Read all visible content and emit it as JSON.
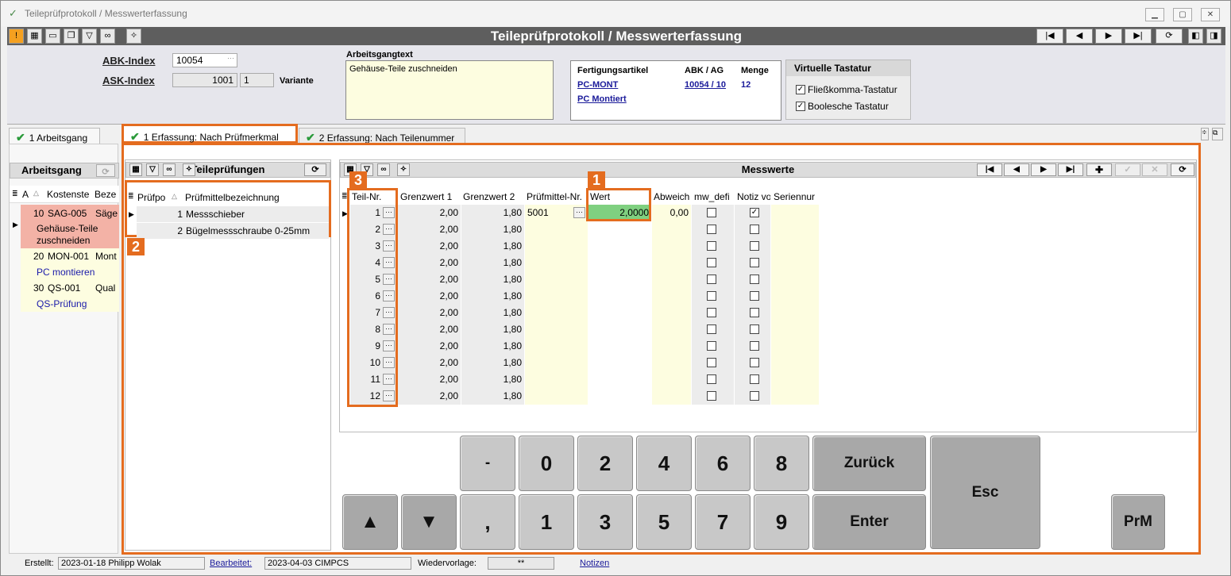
{
  "window": {
    "title": "Teileprüfprotokoll / Messwerterfassung",
    "app_title": "Teileprüfprotokoll / Messwerterfassung"
  },
  "header": {
    "abk_label": "ABK-Index",
    "abk_value": "10054",
    "ask_label": "ASK-Index",
    "ask_value": "1001",
    "ask_value2": "1",
    "variante_label": "Variante",
    "arbeitsgangtext_label": "Arbeitsgangtext",
    "arbeitsgangtext": "Gehäuse-Teile zuschneiden",
    "fert": {
      "col1": "Fertigungsartikel",
      "col2": "ABK / AG",
      "col3": "Menge",
      "article": "PC-MONT",
      "abk_ag": "10054 / 10",
      "menge": "12",
      "desc": "PC Montiert"
    },
    "vt": {
      "title": "Virtuelle Tastatur",
      "opt1": "Fließkomma-Tastatur",
      "opt2": "Boolesche Tastatur"
    }
  },
  "tabs": {
    "t1": "1 Arbeitsgang",
    "t2": "1 Erfassung: Nach Prüfmerkmal",
    "t3": "2 Erfassung: Nach Teilenummer"
  },
  "arbeitsgang": {
    "title": "Arbeitsgang",
    "cols": [
      "A",
      "Kostenste",
      "Beze"
    ],
    "rows": [
      {
        "a": "10",
        "k": "SAG-005",
        "b": "Säge",
        "desc": "Gehäuse-Teile zuschneiden"
      },
      {
        "a": "20",
        "k": "MON-001",
        "b": "Mont",
        "desc": "PC montieren"
      },
      {
        "a": "30",
        "k": "QS-001",
        "b": "Qual",
        "desc": "QS-Prüfung"
      }
    ]
  },
  "teilepruefungen": {
    "title": "Teileprüfungen",
    "cols": [
      "Prüfpo",
      "Prüfmittelbezeichnung"
    ],
    "rows": [
      {
        "n": "1",
        "name": "Messschieber"
      },
      {
        "n": "2",
        "name": "Bügelmessschraube 0-25mm"
      }
    ]
  },
  "messwerte": {
    "title": "Messwerte",
    "cols": [
      "Teil-Nr.",
      "Grenzwert 1",
      "Grenzwert 2",
      "Prüfmittel-Nr.",
      "Wert",
      "Abweich",
      "mw_defi",
      "Notiz vo",
      "Seriennur"
    ],
    "first_pm": "5001",
    "first_wert": "2,0000",
    "first_abw": "0,00",
    "g1": "2,00",
    "g2": "1,80",
    "rows": [
      "1",
      "2",
      "3",
      "4",
      "5",
      "6",
      "7",
      "8",
      "9",
      "10",
      "11",
      "12"
    ]
  },
  "keypad": {
    "minus": "-",
    "comma": ",",
    "k0": "0",
    "k1": "1",
    "k2": "2",
    "k3": "3",
    "k4": "4",
    "k5": "5",
    "k6": "6",
    "k7": "7",
    "k8": "8",
    "k9": "9",
    "up": "▲",
    "down": "▼",
    "back": "Zurück",
    "enter": "Enter",
    "esc": "Esc",
    "prm": "PrM"
  },
  "badges": {
    "b1": "1",
    "b2": "2",
    "b3": "3"
  },
  "status": {
    "erstellt_label": "Erstellt:",
    "erstellt": "2023-01-18  Philipp Wolak",
    "bearbeitet_label": "Bearbeitet:",
    "bearbeitet": "2023-04-03  CIMPCS",
    "wv_label": "Wiedervorlage:",
    "wv": "**",
    "notizen": "Notizen"
  }
}
